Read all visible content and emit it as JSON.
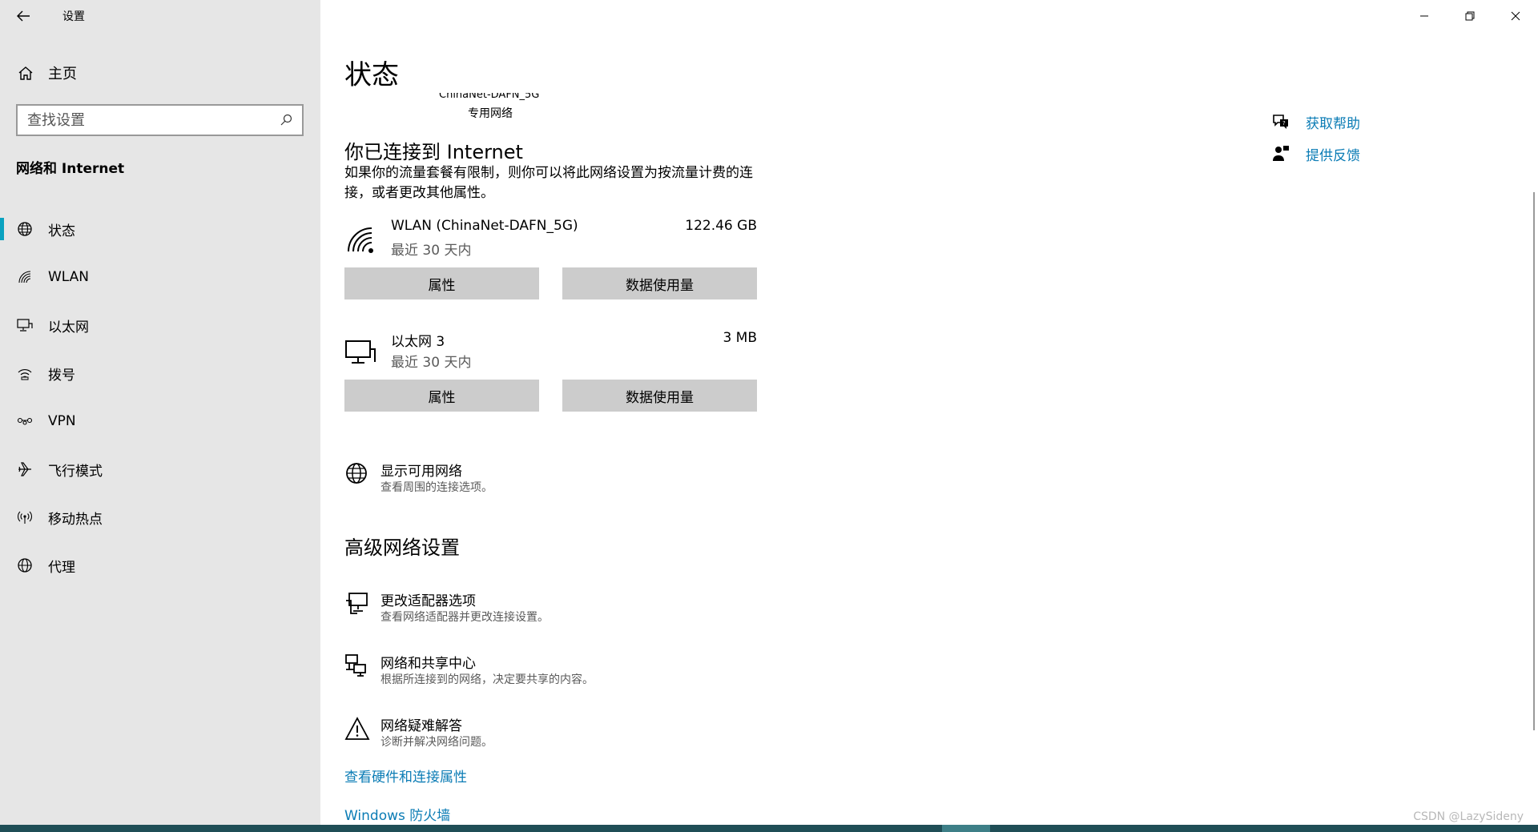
{
  "window": {
    "title": "设置"
  },
  "sidebar": {
    "home_label": "主页",
    "search_placeholder": "查找设置",
    "section_title": "网络和 Internet",
    "items": [
      {
        "label": "状态",
        "icon": "globe-icon",
        "active": true
      },
      {
        "label": "WLAN",
        "icon": "wifi-icon"
      },
      {
        "label": "以太网",
        "icon": "ethernet-icon"
      },
      {
        "label": "拨号",
        "icon": "dialup-icon"
      },
      {
        "label": "VPN",
        "icon": "vpn-icon"
      },
      {
        "label": "飞行模式",
        "icon": "airplane-icon"
      },
      {
        "label": "移动热点",
        "icon": "hotspot-icon"
      },
      {
        "label": "代理",
        "icon": "proxy-globe-icon"
      }
    ]
  },
  "main": {
    "page_title": "状态",
    "network_name_partial": "ChinaNet-DAFN_5G",
    "network_type": "专用网络",
    "connected_heading": "你已连接到 Internet",
    "connected_desc": "如果你的流量套餐有限制，则你可以将此网络设置为按流量计费的连接，或者更改其他属性。",
    "connections": [
      {
        "name": "WLAN (ChinaNet-DAFN_5G)",
        "period": "最近 30 天内",
        "usage": "122.46 GB",
        "btn_properties": "属性",
        "btn_usage": "数据使用量"
      },
      {
        "name": "以太网 3",
        "period": "最近 30 天内",
        "usage": "3 MB",
        "btn_properties": "属性",
        "btn_usage": "数据使用量"
      }
    ],
    "show_networks": {
      "title": "显示可用网络",
      "desc": "查看周围的连接选项。"
    },
    "advanced_heading": "高级网络设置",
    "advanced_items": [
      {
        "title": "更改适配器选项",
        "desc": "查看网络适配器并更改连接设置。"
      },
      {
        "title": "网络和共享中心",
        "desc": "根据所连接到的网络，决定要共享的内容。"
      },
      {
        "title": "网络疑难解答",
        "desc": "诊断并解决网络问题。"
      }
    ],
    "links": {
      "hardware": "查看硬件和连接属性",
      "firewall": "Windows 防火墙"
    }
  },
  "help": {
    "get_help": "获取帮助",
    "feedback": "提供反馈"
  },
  "watermark": "CSDN @LazySideny",
  "colors": {
    "sidebar_bg": "#e6e6e6",
    "accent": "#0aa2c0",
    "link": "#0b7cb5",
    "button": "#cccccc"
  }
}
